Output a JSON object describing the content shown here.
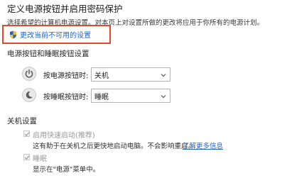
{
  "header": {
    "title": "定义电源按钮并启用密码保护",
    "subtitle": "选择希望的计算机电源设置。对本页上对设置所做的更改将应用于你所有的电源计划。"
  },
  "change_link": {
    "label": "更改当前不可用的设置",
    "icon": "uac-shield-icon",
    "highlight_color": "#e2482a"
  },
  "power_section": {
    "title": "电源按钮和睡眠按钮设置",
    "rows": [
      {
        "label": "按电源按钮时:",
        "value": "关机",
        "icon": "power-icon"
      },
      {
        "label": "按睡眠按钮时:",
        "value": "睡眠",
        "icon": "sleep-icon"
      }
    ]
  },
  "shutdown_section": {
    "title": "关机设置",
    "options": [
      {
        "label": "启用快速启动(推荐)",
        "checked": true,
        "description": "这有助于在关机之后更快地启动电脑。不会影响重启。",
        "link": "了解更多信息"
      },
      {
        "label": "睡眠",
        "checked": true,
        "description": "显示在\"电源\"菜单中。"
      }
    ]
  },
  "colors": {
    "link": "#1e64c8",
    "disabled_text": "#9a9a9a"
  }
}
